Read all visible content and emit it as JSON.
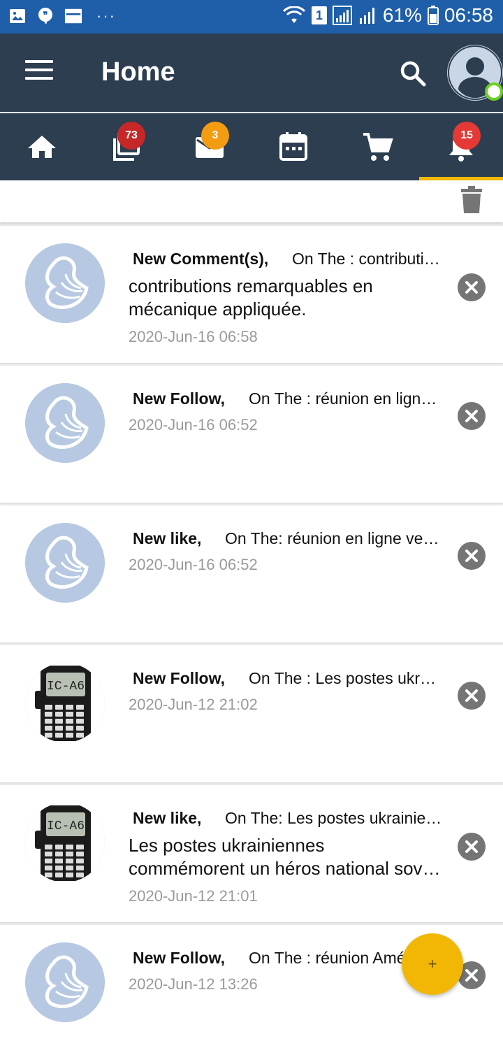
{
  "status_bar": {
    "battery": "61%",
    "time": "06:58",
    "sim": "1"
  },
  "app_bar": {
    "title": "Home"
  },
  "tabs": [
    {
      "name": "home",
      "icon": "home-icon"
    },
    {
      "name": "posts",
      "icon": "copy-icon",
      "badge": "73",
      "badge_color": "#c62828"
    },
    {
      "name": "messages",
      "icon": "mail-icon",
      "badge": "3",
      "badge_color": "#f39c12"
    },
    {
      "name": "events",
      "icon": "calendar-icon"
    },
    {
      "name": "shop",
      "icon": "cart-icon"
    },
    {
      "name": "notifications",
      "icon": "bell-icon",
      "badge": "15",
      "badge_color": "#e53935",
      "active": true
    }
  ],
  "notifications": [
    {
      "type": "New  Comment(s),",
      "on": "On The : contributions remarquables en mécanique appliquée.",
      "message": [
        "contributions remarquables en",
        "mécanique appliquée."
      ],
      "date": "2020-Jun-16 06:58",
      "thumb": "logo"
    },
    {
      "type": "New Follow,",
      "on": "On The : réunion en ligne vendredi",
      "message": [],
      "date": "2020-Jun-16 06:52",
      "thumb": "logo"
    },
    {
      "type": "New like,",
      "on": "On The: réunion en ligne vendredi",
      "message": [],
      "date": "2020-Jun-16 06:52",
      "thumb": "logo"
    },
    {
      "type": "New Follow,",
      "on": "On The : Les postes ukrainiennes",
      "message": [],
      "date": "2020-Jun-12 21:02",
      "thumb": "radio"
    },
    {
      "type": "New like,",
      "on": "On The: Les postes ukrainiennes",
      "message": [
        "Les postes ukrainiennes",
        "commémorent un héros national soviétique"
      ],
      "date": "2020-Jun-12 21:01",
      "thumb": "radio"
    },
    {
      "type": "New Follow,",
      "on": "On The : réunion Américaine",
      "message": [],
      "date": "2020-Jun-12 13:26",
      "thumb": "logo"
    }
  ],
  "fab": {
    "label": "+"
  },
  "colors": {
    "status_bar": "#1f5ea8",
    "app_bar": "#2c3e50",
    "accent": "#f2b705"
  },
  "radio_screen": "IC-A6"
}
